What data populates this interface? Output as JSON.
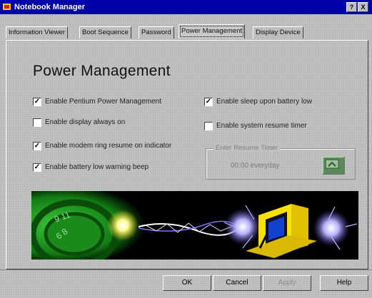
{
  "window": {
    "title": "Notebook Manager",
    "help_button": "?",
    "close_button": "X"
  },
  "tabs": [
    {
      "label": "Information Viewer",
      "active": false
    },
    {
      "label": "Boot Sequence",
      "active": false
    },
    {
      "label": "Password",
      "active": false
    },
    {
      "label": "Power Management",
      "active": true
    },
    {
      "label": "Display Device",
      "active": false
    }
  ],
  "page": {
    "heading": "Power Management"
  },
  "options": {
    "enable_power_mgmt": {
      "label": "Enable Pentium Power Management",
      "checked": true
    },
    "display_always_on": {
      "label": "Enable display always on",
      "checked": false
    },
    "modem_ring_resume": {
      "label": "Enable modem ring resume on indicator",
      "checked": true
    },
    "battery_low_beep": {
      "label": "Enable battery low warning beep",
      "checked": true
    },
    "sleep_battery_low": {
      "label": "Enable sleep upon battery low",
      "checked": true
    },
    "resume_timer": {
      "label": "Enable system resume timer",
      "checked": false
    }
  },
  "resume_timer_group": {
    "title": "Enter Resume Timer",
    "value": "00:00 everyday"
  },
  "buttons": {
    "ok": "OK",
    "cancel": "Cancel",
    "apply": "Apply",
    "help": "Help"
  },
  "colors": {
    "titlebar": "#0000a8",
    "banner_green": "#1f9a1f",
    "monitor_yellow": "#f0d000"
  }
}
